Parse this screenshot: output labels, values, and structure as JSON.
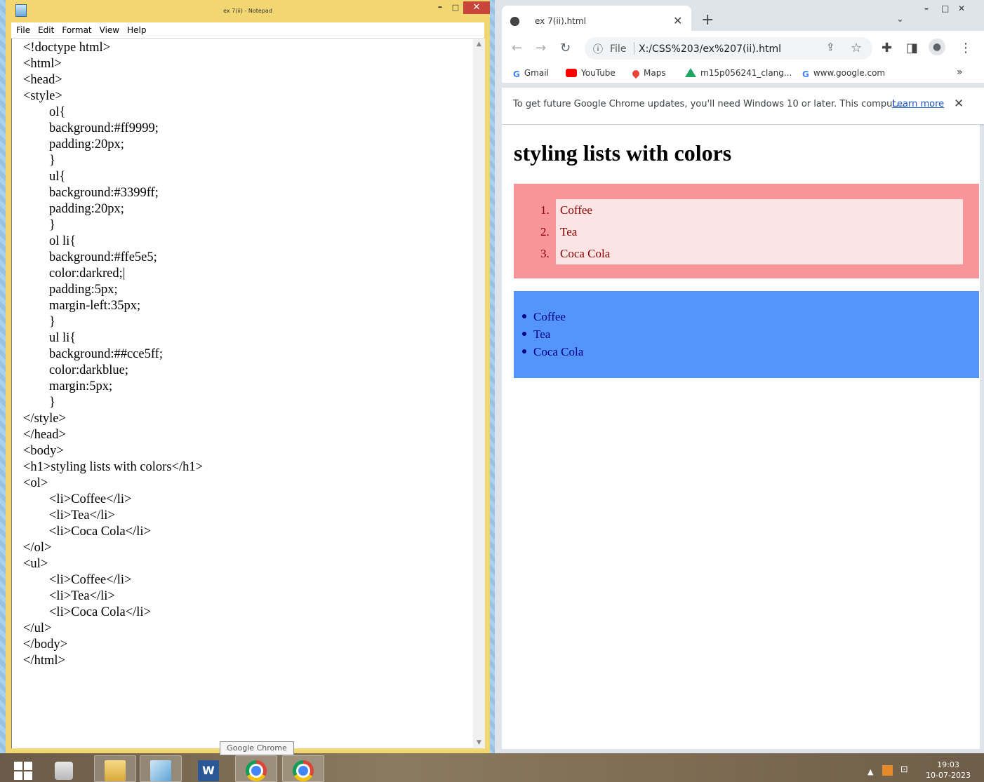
{
  "notepad": {
    "title": "ex 7(ii) - Notepad",
    "menu": [
      "File",
      "Edit",
      "Format",
      "View",
      "Help"
    ],
    "content": "<!doctype html>\n<html>\n<head>\n<style>\n\tol{\n\tbackground:#ff9999;\n\tpadding:20px;\n\t}\n\tul{\n\tbackground:#3399ff;\n\tpadding:20px;\n\t}\n\tol li{\n\tbackground:#ffe5e5;\n\tcolor:darkred;|\n\tpadding:5px;\n\tmargin-left:35px;\n\t}\n\tul li{\n\tbackground:##cce5ff;\n\tcolor:darkblue;\n\tmargin:5px;\n\t}\n</style>\n</head>\n<body>\n<h1>styling lists with colors</h1>\n<ol>\n\t<li>Coffee</li>\n\t<li>Tea</li>\n\t<li>Coca Cola</li>\n</ol>\n<ul>\n\t<li>Coffee</li>\n\t<li>Tea</li>\n\t<li>Coca Cola</li>\n</ul>\n</body>\n</html>"
  },
  "chrome": {
    "tab_title": "ex 7(ii).html",
    "omnibox": {
      "scheme_label": "File",
      "url": "X:/CSS%203/ex%207(ii).html"
    },
    "bookmarks": [
      "Gmail",
      "YouTube",
      "Maps",
      "m15p056241_clang...",
      "www.google.com"
    ],
    "bookmarks_overflow": "»",
    "banner": {
      "text": "To get future Google Chrome updates, you'll need Windows 10 or later. This comput...",
      "link": "Learn more"
    },
    "page": {
      "heading": "styling lists with colors",
      "ordered_items": [
        "Coffee",
        "Tea",
        "Coca Cola"
      ],
      "ordered_numbers": [
        "1.",
        "2.",
        "3."
      ],
      "unordered_items": [
        "Coffee",
        "Tea",
        "Coca Cola"
      ]
    }
  },
  "taskbar": {
    "tooltip": "Google Chrome",
    "clock_time": "19:03",
    "clock_date": "10-07-2023"
  },
  "colors": {
    "notepad_frame": "#f2d672",
    "ol_background": "#ff9999",
    "ol_item_background": "#ffe5e5",
    "ul_background": "#3399ff",
    "ol_text": "darkred",
    "ul_text": "darkblue"
  },
  "icons": [
    "notepad-icon",
    "chrome-tab-icon",
    "back-icon",
    "forward-icon",
    "reload-icon",
    "info-icon",
    "share-icon",
    "star-icon",
    "extensions-icon",
    "side-panel-icon",
    "profile-icon",
    "menu-icon",
    "windows-start-icon",
    "file-explorer-icon",
    "word-icon",
    "chrome-icon"
  ]
}
